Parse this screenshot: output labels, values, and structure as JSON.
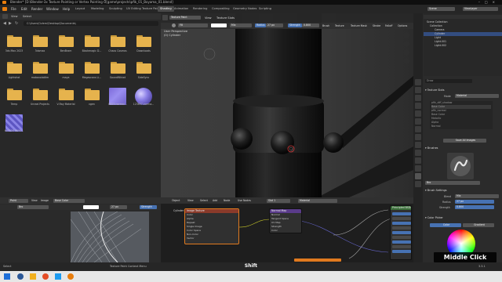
{
  "window": {
    "title": "Blender* [D:\\Blender-3x Texture Painting or Vertex Painting Ö[game\\projects\\pfik_01_Boyama_01.blend]"
  },
  "menubar": {
    "items": [
      "File",
      "Edit",
      "Render",
      "Window",
      "Help"
    ],
    "workspaces": [
      "Layout",
      "Modeling",
      "Sculpting",
      "UV Editing",
      "Texture Paint",
      "Shading",
      "Animation",
      "Rendering",
      "Compositing",
      "Geometry Nodes",
      "Scripting"
    ],
    "active_workspace": "Shading",
    "scene_label": "Scene",
    "view_layer_label": "ViewLayer"
  },
  "file_browser": {
    "header_items": [
      "View",
      "Select"
    ],
    "path": "C:\\Users\\Ozlem\\Desktop\\Documents\\",
    "items": [
      {
        "label": "3ds Max 2023",
        "kind": "folder"
      },
      {
        "label": "3dsmax",
        "kind": "folder"
      },
      {
        "label": "BenBram",
        "kind": "folder"
      },
      {
        "label": "Blackmagic D...",
        "kind": "folder"
      },
      {
        "label": "Chaos Cosmos",
        "kind": "folder"
      },
      {
        "label": "Downloads",
        "kind": "folder"
      },
      {
        "label": "Lightshot",
        "kind": "folder"
      },
      {
        "label": "mabanolattim",
        "kind": "folder"
      },
      {
        "label": "maya",
        "kind": "folder"
      },
      {
        "label": "Megascans Li...",
        "kind": "folder"
      },
      {
        "label": "SoundWhiwt",
        "kind": "folder"
      },
      {
        "label": "SideSync",
        "kind": "folder"
      },
      {
        "label": "Temp",
        "kind": "folder"
      },
      {
        "label": "Unreal Projects",
        "kind": "folder"
      },
      {
        "label": "V-Ray Material",
        "kind": "folder"
      },
      {
        "label": "vgen",
        "kind": "folder"
      },
      {
        "label": "8923-normal...",
        "kind": "normal"
      },
      {
        "label": "123657-norma...",
        "kind": "sphere"
      },
      {
        "label": "6a7556.9590...",
        "kind": "weave"
      }
    ]
  },
  "viewport": {
    "mode": "Texture Paint",
    "menu": [
      "View",
      "Texture Slots"
    ],
    "brush_field": "Fill",
    "blend_mode": "Mix",
    "radius_label": "Radius",
    "radius_value": "27 px",
    "strength_label": "Strength",
    "strength_value": "0.800",
    "right_menus": [
      "Brush",
      "Texture",
      "Texture Mask",
      "Stroke",
      "Falloff",
      "Options"
    ],
    "info_line1": "User Perspective",
    "info_line2": "(0) Cylinder"
  },
  "outliner": {
    "title": "Scene Collection",
    "rows": [
      {
        "label": "Collection",
        "selected": false
      },
      {
        "label": "Camera",
        "selected": false
      },
      {
        "label": "Cylinder",
        "selected": true
      },
      {
        "label": "Light",
        "selected": false
      },
      {
        "label": "Light.001",
        "selected": false
      },
      {
        "label": "Light.002",
        "selected": false
      }
    ]
  },
  "properties": {
    "search_placeholder": "Draw",
    "texture_slots_header": "Texture Slots",
    "mode_label": "Mode",
    "mode_value": "Material",
    "slots": [
      "pfik_diff_shadow",
      "Base Color",
      "pfik_normal",
      "Base Color",
      "Metallic",
      "Alpha",
      "Normal"
    ],
    "save_images_label": "Save All Images",
    "brushes_header": "Brushes",
    "brush_name": "Bro",
    "brush_settings_header": "Brush Settings",
    "blend_label": "Blend",
    "blend_value": "Mix",
    "radius_label": "Radius",
    "radius_value": "27 px",
    "strength_label": "Strength",
    "strength_value": "0.800",
    "color_picker_header": "Color Picker",
    "color_tabs": [
      "Color",
      "Gradient"
    ]
  },
  "image_editor": {
    "mode": "Paint",
    "menu": [
      "View",
      "Image"
    ],
    "blend": "Base Color",
    "brush_field": "Bro",
    "radius_value": "27 px",
    "strength_label": "Strength"
  },
  "node_editor": {
    "header": [
      "Object",
      "View",
      "Select",
      "Add",
      "Node",
      "Use Nodes"
    ],
    "slot_label": "Slot 1",
    "material_label": "Material",
    "object_label": "Cylinder",
    "nodes": [
      {
        "title": "Image Texture",
        "color": "#8a3a2a",
        "rows": [
          "Color",
          "Alpha",
          "Repeat",
          "Single Image",
          "Color Space",
          "Non-Color",
          "Vector"
        ]
      },
      {
        "title": "Normal Map",
        "color": "#5a3b8a",
        "rows": [
          "Normal",
          "Tangent Space",
          "UV Map",
          "Strength",
          "Color"
        ]
      },
      {
        "title": "Principled BSDF",
        "color": "#3b6e3a",
        "rows": []
      }
    ]
  },
  "statusbar": {
    "left": "Select",
    "right_hint": "Texture Paint Context Menu",
    "version": "3.3.1",
    "overlay_key": "Shift"
  },
  "overlay": {
    "key_hint": "Middle Click"
  },
  "colors": {
    "accent": "#4772b3",
    "folder": "#e6b34d",
    "outliner_selected": "#334d80"
  }
}
